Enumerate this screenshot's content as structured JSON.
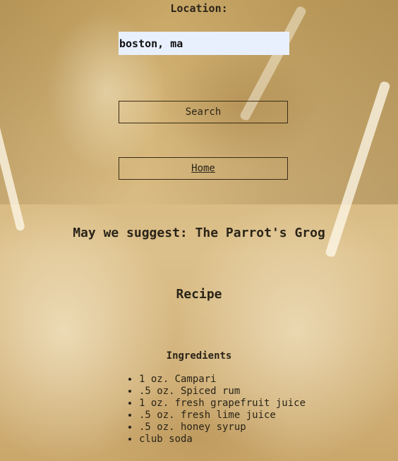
{
  "location": {
    "label": "Location:",
    "value": "boston, ma"
  },
  "buttons": {
    "search_label": "Search",
    "home_label": "Home"
  },
  "suggestion": {
    "text": "May we suggest: The Parrot's Grog"
  },
  "recipe": {
    "title": "Recipe",
    "ingredients_title": "Ingredients",
    "ingredients": [
      "1 oz. Campari",
      ".5 oz. Spiced rum",
      "1 oz. fresh grapefruit juice",
      ".5 oz. fresh lime juice",
      ".5 oz. honey syrup",
      "club soda"
    ]
  }
}
